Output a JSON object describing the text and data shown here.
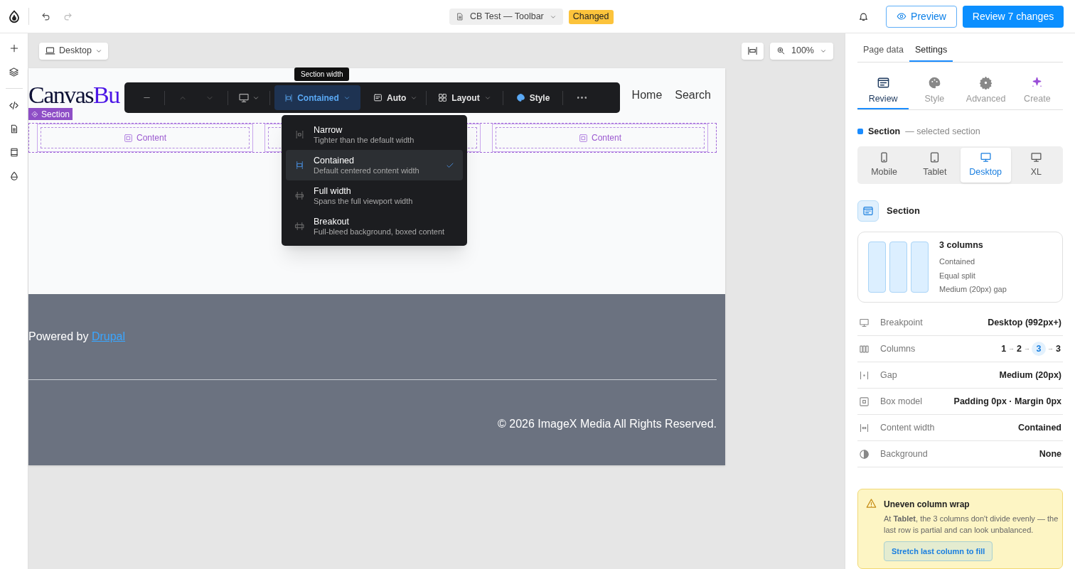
{
  "topbar": {
    "document": "CB Test — Toolbar",
    "status": "Changed",
    "preview": "Preview",
    "review": "Review 7 changes"
  },
  "canvas": {
    "device": "Desktop",
    "zoom": "100%"
  },
  "site": {
    "logo": [
      {
        "text": "Canvas",
        "accent": false
      },
      {
        "text": "Bu",
        "accent": true
      }
    ],
    "nav": [
      "Home",
      "Search"
    ],
    "section_label": "Section",
    "columns": [
      {
        "kind": "labeled",
        "label": "Content"
      },
      {
        "kind": "covered"
      },
      {
        "kind": "labeled",
        "label": "Content"
      }
    ],
    "footer": {
      "powered_by": "Powered by",
      "link": "Drupal",
      "copyright": "© 2026 ImageX Media All Rights Reserved."
    }
  },
  "toolbar": {
    "tooltip": "Section width",
    "width": "Contained",
    "height": "Auto",
    "layout": "Layout",
    "style": "Style",
    "width_options": [
      {
        "label": "Narrow",
        "description": "Tighter than the default width",
        "selected": false
      },
      {
        "label": "Contained",
        "description": "Default centered content width",
        "selected": true
      },
      {
        "label": "Full width",
        "description": "Spans the full viewport width",
        "selected": false
      },
      {
        "label": "Breakout",
        "description": "Full-bleed background, boxed content",
        "selected": false
      }
    ]
  },
  "panel": {
    "tabs": [
      {
        "label": "Page data",
        "selected": false
      },
      {
        "label": "Settings",
        "selected": true
      }
    ],
    "modes": [
      {
        "label": "Review",
        "selected": true
      },
      {
        "label": "Style",
        "selected": false
      },
      {
        "label": "Advanced",
        "selected": false
      },
      {
        "label": "Create",
        "selected": false
      }
    ],
    "selection": {
      "title": "Section",
      "note": "— selected section"
    },
    "devices": [
      {
        "label": "Mobile",
        "selected": false
      },
      {
        "label": "Tablet",
        "selected": false
      },
      {
        "label": "Desktop",
        "selected": true
      },
      {
        "label": "XL",
        "selected": false
      }
    ],
    "component": "Section",
    "summary": {
      "title": "3 columns",
      "lines": [
        "Contained",
        "Equal split",
        "Medium (20px) gap"
      ]
    },
    "properties": [
      {
        "kind": "text",
        "label": "Breakpoint",
        "value": "Desktop (992px+)"
      },
      {
        "kind": "steps",
        "label": "Columns",
        "separator": "→",
        "steps": [
          {
            "text": "1",
            "selected": false
          },
          {
            "text": "2",
            "selected": false
          },
          {
            "text": "3",
            "selected": true
          },
          {
            "text": "3",
            "selected": false
          }
        ]
      },
      {
        "kind": "text",
        "label": "Gap",
        "value": "Medium (20px)"
      },
      {
        "kind": "text",
        "label": "Box model",
        "value": "Padding 0px · Margin 0px"
      },
      {
        "kind": "text",
        "label": "Content width",
        "value": "Contained"
      },
      {
        "kind": "text",
        "label": "Background",
        "value": "None"
      }
    ],
    "alert": {
      "title": "Uneven column wrap",
      "text": "At **Tablet**, the 3 columns don't divide evenly — the last row is partial and can look unbalanced.",
      "action": "Stretch last column to fill"
    }
  }
}
